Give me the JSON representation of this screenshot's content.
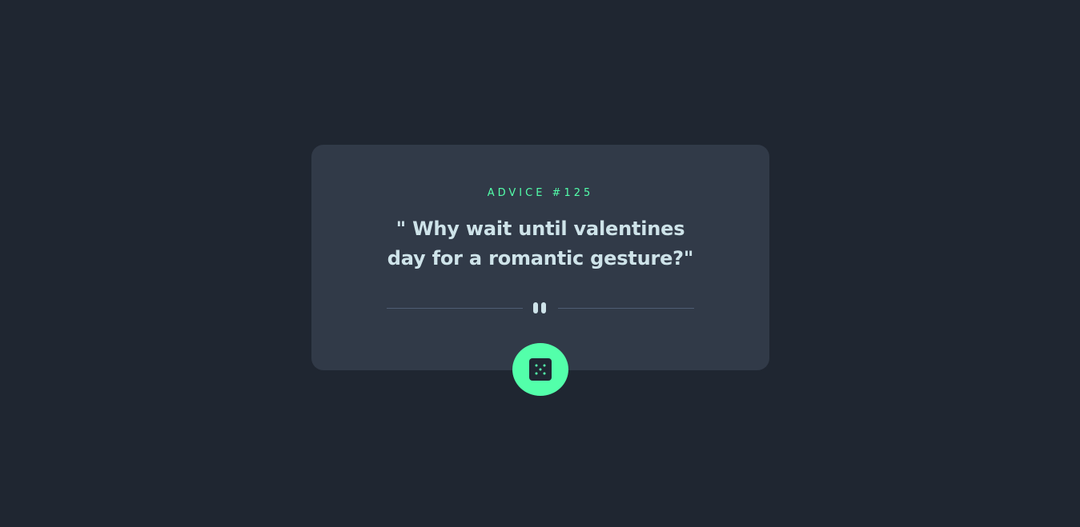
{
  "card": {
    "advice_label": "ADVICE #125",
    "quote": "\" Why wait until valentines day for a romantic gesture?\""
  },
  "divider": {
    "icon": "pause-icon"
  },
  "dice_button": {
    "icon": "dice-icon"
  },
  "colors": {
    "background": "#1f2631",
    "card": "#313a48",
    "accent": "#53ffaa",
    "text": "#cee3e9",
    "divider": "#4f5d74"
  }
}
